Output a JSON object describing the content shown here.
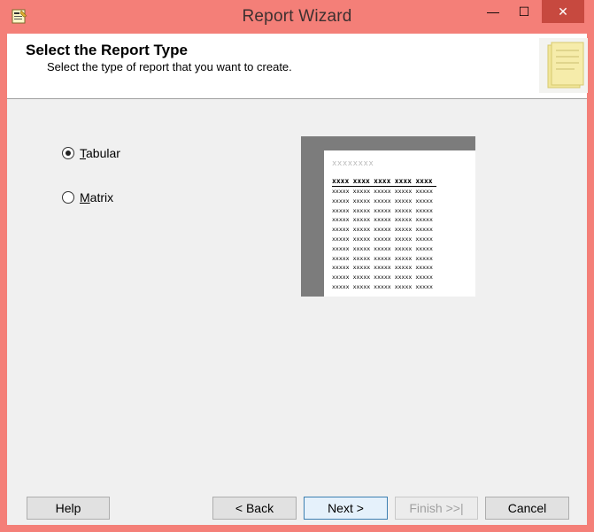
{
  "window": {
    "title": "Report Wizard",
    "minimize_glyph": "—",
    "maximize_glyph": "☐",
    "close_glyph": "✕",
    "frame_color": "#f47f78",
    "close_color": "#c7493f"
  },
  "header": {
    "title": "Select the Report Type",
    "subtitle": "Select the type of report that you want to create."
  },
  "options": {
    "tabular": {
      "mnemonic": "T",
      "rest": "abular",
      "selected": true
    },
    "matrix": {
      "mnemonic": "M",
      "rest": "atrix",
      "selected": false
    }
  },
  "preview": {
    "placeholder": "xxxxxxxx",
    "headers": [
      "xxxx",
      "xxxx",
      "xxxx",
      "xxxx",
      "xxxx"
    ],
    "cell": "xxxxx",
    "row_count": 11
  },
  "buttons": {
    "help": "Help",
    "back": "< Back",
    "next": "Next >",
    "finish": "Finish >>|",
    "cancel": "Cancel"
  }
}
